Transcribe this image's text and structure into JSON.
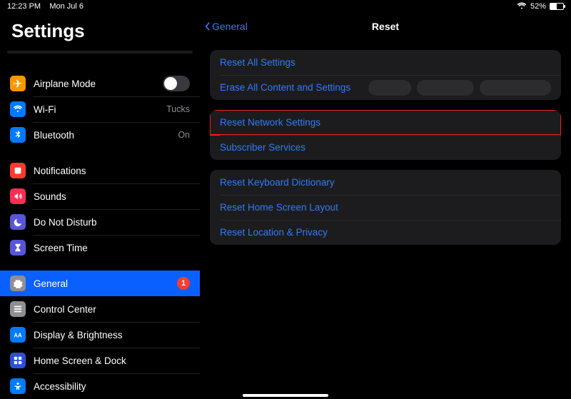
{
  "statusbar": {
    "time": "12:23 PM",
    "date": "Mon Jul 6",
    "battery_pct": "52%"
  },
  "sidebar": {
    "title": "Settings",
    "airplane_mode": "Airplane Mode",
    "wifi_label": "Wi-Fi",
    "wifi_value": "Tucks",
    "bluetooth_label": "Bluetooth",
    "bluetooth_value": "On",
    "notifications": "Notifications",
    "sounds": "Sounds",
    "dnd": "Do Not Disturb",
    "screen_time": "Screen Time",
    "general": "General",
    "general_badge": "1",
    "control_center": "Control Center",
    "display_brightness": "Display & Brightness",
    "home_screen_dock": "Home Screen & Dock",
    "accessibility": "Accessibility"
  },
  "detail": {
    "back": "General",
    "title": "Reset",
    "group1": {
      "reset_all": "Reset All Settings",
      "erase_all": "Erase All Content and Settings"
    },
    "group2": {
      "network": "Reset Network Settings",
      "subscriber": "Subscriber Services"
    },
    "group3": {
      "keyboard": "Reset Keyboard Dictionary",
      "home": "Reset Home Screen Layout",
      "location": "Reset Location & Privacy"
    }
  },
  "colors": {
    "icon_orange": "#ff9500",
    "icon_blue": "#007aff",
    "icon_red": "#ff3b30",
    "icon_redpink": "#ff2d55",
    "icon_purple": "#5856d6",
    "icon_gray": "#8e8e93"
  }
}
